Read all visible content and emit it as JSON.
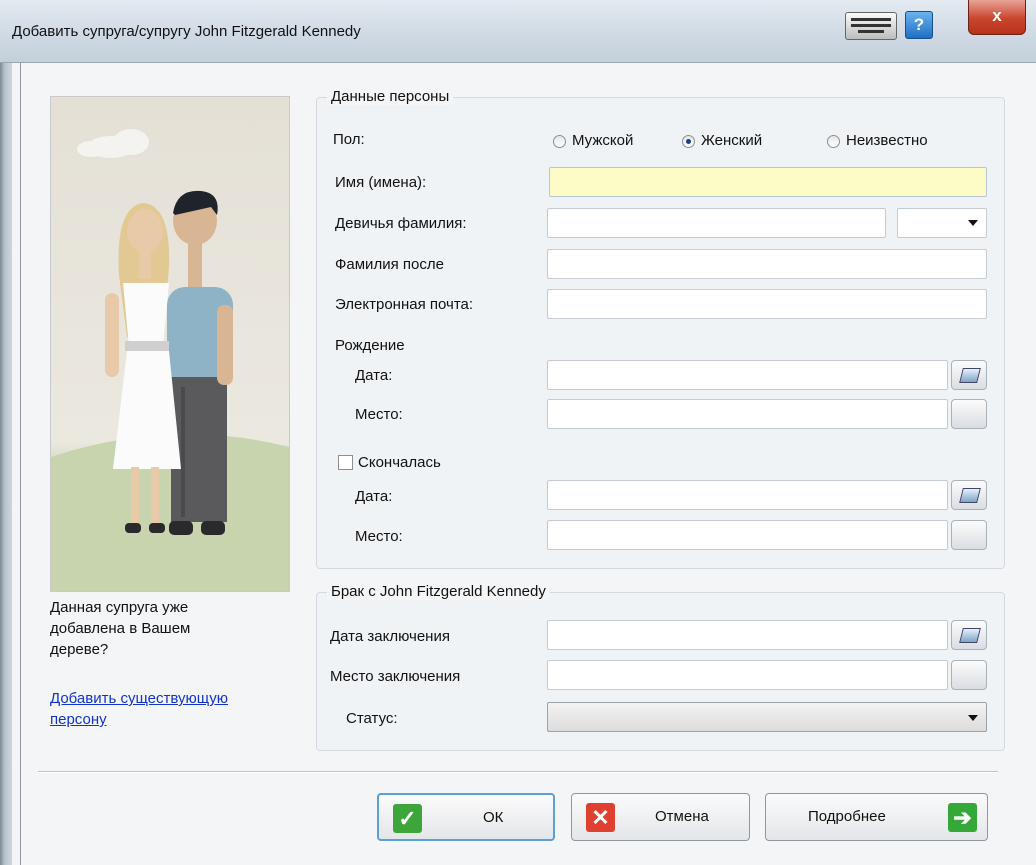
{
  "window": {
    "title": "Добавить супруга/супругу John Fitzgerald Kennedy",
    "close_glyph": "x",
    "help_glyph": "?"
  },
  "sidebar": {
    "question": "Данная супруга уже добавлена в Вашем дереве?",
    "question_lines": [
      "Данная супруга уже",
      "добавлена в Вашем",
      "дереве?"
    ],
    "link_lines": [
      "Добавить существующую",
      "персону"
    ]
  },
  "person": {
    "legend": "Данные персоны",
    "gender_label": "Пол:",
    "gender_options": [
      {
        "label": "Мужской",
        "selected": false
      },
      {
        "label": "Женский",
        "selected": true
      },
      {
        "label": "Неизвестно",
        "selected": false
      }
    ],
    "first_name_label": "Имя (имена):",
    "first_name_value": "",
    "maiden_name_label": "Девичья фамилия:",
    "maiden_name_value": "",
    "suffix_value": "",
    "married_name_label": "Фамилия после",
    "married_name_value": "",
    "email_label": "Электронная почта:",
    "email_value": "",
    "birth_label": "Рождение",
    "birth_date_label": "Дата:",
    "birth_date_value": "",
    "birth_place_label": "Место:",
    "birth_place_value": "",
    "deceased_label": "Скончалась",
    "deceased_checked": false,
    "death_date_label": "Дата:",
    "death_date_value": "",
    "death_place_label": "Место:",
    "death_place_value": ""
  },
  "marriage": {
    "legend": "Брак с John Fitzgerald Kennedy",
    "date_label": "Дата заключения",
    "date_value": "",
    "place_label": "Место заключения",
    "place_value": "",
    "status_label": "Статус:",
    "status_value": ""
  },
  "buttons": {
    "ok": "ОК",
    "cancel": "Отмена",
    "more": "Подробнее"
  },
  "colors": {
    "ok_icon": "#3ea53a",
    "cancel_icon": "#e04030",
    "more_icon": "#35a83a",
    "link": "#1133cc",
    "required_field": "#fdfbc6"
  }
}
